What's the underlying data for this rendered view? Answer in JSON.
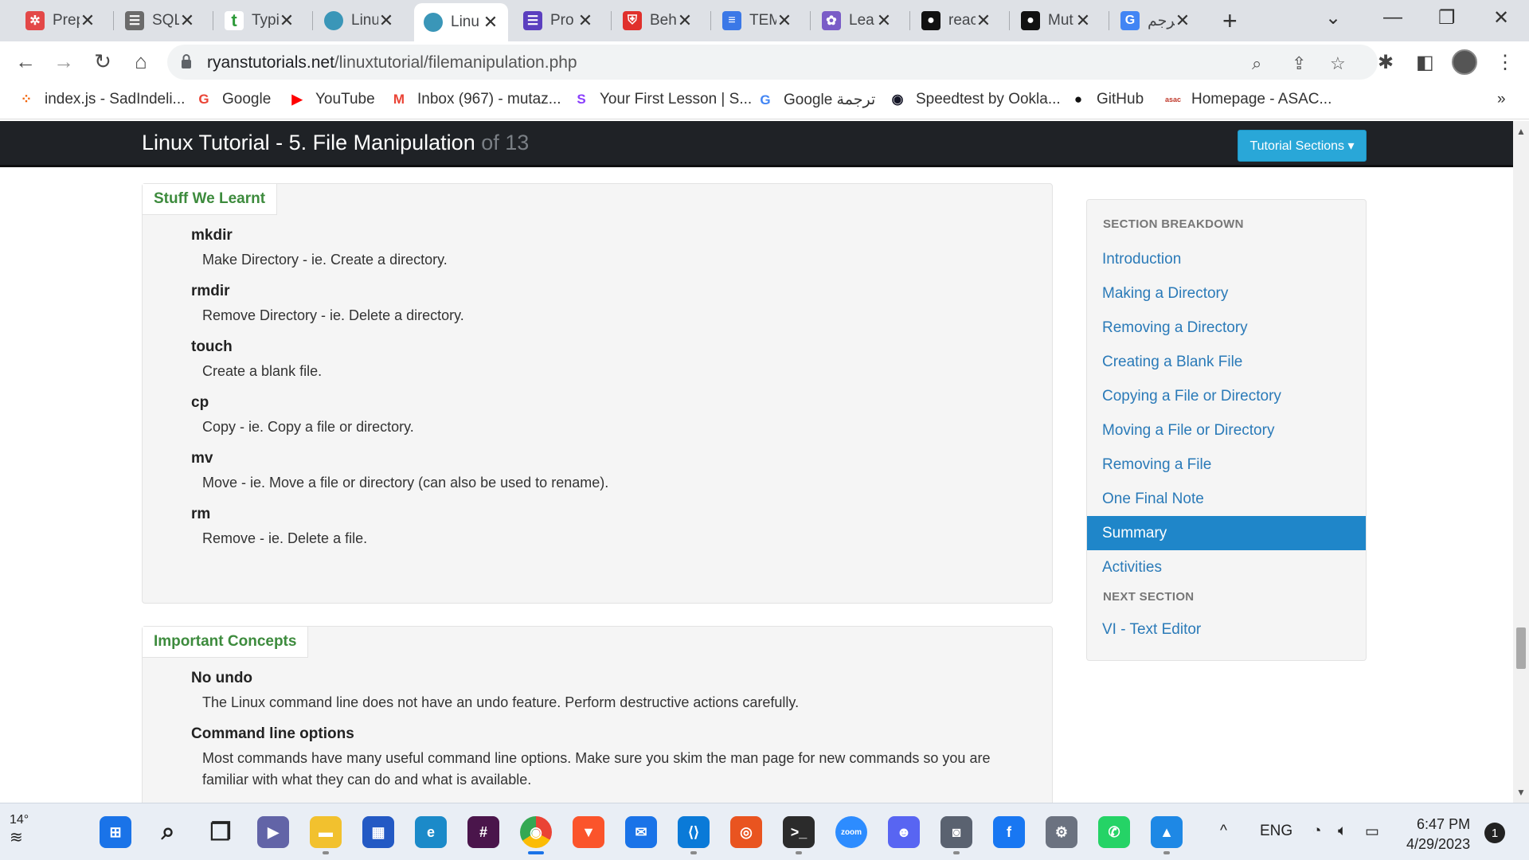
{
  "browser": {
    "tabs": [
      {
        "title": "Prep",
        "favicon": "gear-red",
        "color": "#e34848",
        "glyph": "✲"
      },
      {
        "title": "SQL",
        "favicon": "database",
        "color": "#6b6b6b",
        "glyph": "☰"
      },
      {
        "title": "Typi",
        "favicon": "typing-t",
        "color": "#ffffff",
        "glyph": "t"
      },
      {
        "title": "Linu",
        "favicon": "circle-teal",
        "color": "#3a96b8",
        "glyph": ""
      },
      {
        "title": "Linu",
        "favicon": "circle-teal",
        "color": "#3a96b8",
        "glyph": ""
      },
      {
        "title": "Pro",
        "favicon": "list-purple",
        "color": "#5b3fbf",
        "glyph": "☰"
      },
      {
        "title": "Beh",
        "favicon": "shield-red",
        "color": "#e0302c",
        "glyph": "⛨"
      },
      {
        "title": "TEM",
        "favicon": "docs-blue",
        "color": "#3b78e7",
        "glyph": "≡"
      },
      {
        "title": "Lea",
        "favicon": "puzzle-color",
        "color": "#7a5cc7",
        "glyph": "✿"
      },
      {
        "title": "reac",
        "favicon": "github",
        "color": "#111111",
        "glyph": "●"
      },
      {
        "title": "Mut",
        "favicon": "github",
        "color": "#111111",
        "glyph": "●"
      },
      {
        "title": "ترجم",
        "favicon": "google-translate",
        "color": "#4285f4",
        "glyph": "G"
      }
    ],
    "active_tab_index": 4,
    "url_host": "ryanstutorials.net",
    "url_path": "/linuxtutorial/filemanipulation.php",
    "bookmarks": [
      {
        "label": "index.js - SadIndeli...",
        "color": "#f26207",
        "glyph": "⁘"
      },
      {
        "label": "Google",
        "color": "#ea4335",
        "glyph": "G"
      },
      {
        "label": "YouTube",
        "color": "#ff0000",
        "glyph": "▶"
      },
      {
        "label": "Inbox (967) - mutaz...",
        "color": "#ea4335",
        "glyph": "M"
      },
      {
        "label": "Your First Lesson | S...",
        "color": "#8a3ffc",
        "glyph": "S"
      },
      {
        "label": "Google ترجمة",
        "color": "#4285f4",
        "glyph": "G"
      },
      {
        "label": "Speedtest by Ookla...",
        "color": "#141526",
        "glyph": "◉"
      },
      {
        "label": "GitHub",
        "color": "#111111",
        "glyph": "●"
      },
      {
        "label": "Homepage - ASAC...",
        "color": "#c0392b",
        "glyph": "asac"
      }
    ],
    "more_bookmarks": "»"
  },
  "site": {
    "title": "Linux Tutorial - 5. File Manipulation",
    "of_label": "of 13",
    "sections_button": "Tutorial Sections ▾"
  },
  "stuff_we_learnt": {
    "heading": "Stuff We Learnt",
    "items": [
      {
        "name": "mkdir",
        "desc": "Make Directory - ie. Create a directory."
      },
      {
        "name": "rmdir",
        "desc": "Remove Directory - ie. Delete a directory."
      },
      {
        "name": "touch",
        "desc": "Create a blank file."
      },
      {
        "name": "cp",
        "desc": "Copy - ie. Copy a file or directory."
      },
      {
        "name": "mv",
        "desc": "Move - ie. Move a file or directory (can also be used to rename)."
      },
      {
        "name": "rm",
        "desc": "Remove - ie. Delete a file."
      }
    ]
  },
  "important_concepts": {
    "heading": "Important Concepts",
    "items": [
      {
        "name": "No undo",
        "desc": "The Linux command line does not have an undo feature. Perform destructive actions carefully."
      },
      {
        "name": "Command line options",
        "desc": "Most commands have many useful command line options. Make sure you skim the man page for new commands so you are familiar with what they can do and what is available."
      }
    ]
  },
  "sidebar": {
    "breakdown_heading": "SECTION BREAKDOWN",
    "links": [
      "Introduction",
      "Making a Directory",
      "Removing a Directory",
      "Creating a Blank File",
      "Copying a File or Directory",
      "Moving a File or Directory",
      "Removing a File",
      "One Final Note",
      "Summary",
      "Activities"
    ],
    "active_link": "Summary",
    "next_heading": "NEXT SECTION",
    "next_link": "VI - Text Editor"
  },
  "taskbar": {
    "weather_temp": "14°",
    "apps": [
      {
        "name": "start-icon",
        "color": "#1a73e8",
        "glyph": "⊞"
      },
      {
        "name": "search-icon",
        "color": "#e9eef5",
        "glyph": "⌕"
      },
      {
        "name": "task-view-icon",
        "color": "#e9eef5",
        "glyph": "❐"
      },
      {
        "name": "teams-chat-icon",
        "color": "#6264a7",
        "glyph": "▶"
      },
      {
        "name": "file-explorer-icon",
        "color": "#f2c12e",
        "glyph": "▬"
      },
      {
        "name": "store-icon",
        "color": "#2359c4",
        "glyph": "▦"
      },
      {
        "name": "edge-icon",
        "color": "#1b8ac9",
        "glyph": "e"
      },
      {
        "name": "slack-icon",
        "color": "#4a154b",
        "glyph": "#"
      },
      {
        "name": "chrome-icon",
        "color": "#34a853",
        "glyph": "◉"
      },
      {
        "name": "brave-icon",
        "color": "#fb542b",
        "glyph": "▼"
      },
      {
        "name": "mail-icon",
        "color": "#1a73e8",
        "glyph": "✉"
      },
      {
        "name": "vscode-icon",
        "color": "#0a7ad8",
        "glyph": "⟨⟩"
      },
      {
        "name": "ubuntu-icon",
        "color": "#e95420",
        "glyph": "◎"
      },
      {
        "name": "terminal-icon",
        "color": "#2b2b2b",
        "glyph": ">_"
      },
      {
        "name": "zoom-icon",
        "color": "#2d8cff",
        "glyph": "zoom"
      },
      {
        "name": "discord-icon",
        "color": "#5865f2",
        "glyph": "☻"
      },
      {
        "name": "camera-icon",
        "color": "#5a6270",
        "glyph": "◙"
      },
      {
        "name": "facebook-icon",
        "color": "#1877f2",
        "glyph": "f"
      },
      {
        "name": "settings-icon",
        "color": "#6b7280",
        "glyph": "⚙"
      },
      {
        "name": "whatsapp-icon",
        "color": "#25d366",
        "glyph": "✆"
      },
      {
        "name": "photos-icon",
        "color": "#1e88e5",
        "glyph": "▲"
      }
    ],
    "language": "ENG",
    "time": "6:47 PM",
    "date": "4/29/2023",
    "notifications": "1"
  }
}
